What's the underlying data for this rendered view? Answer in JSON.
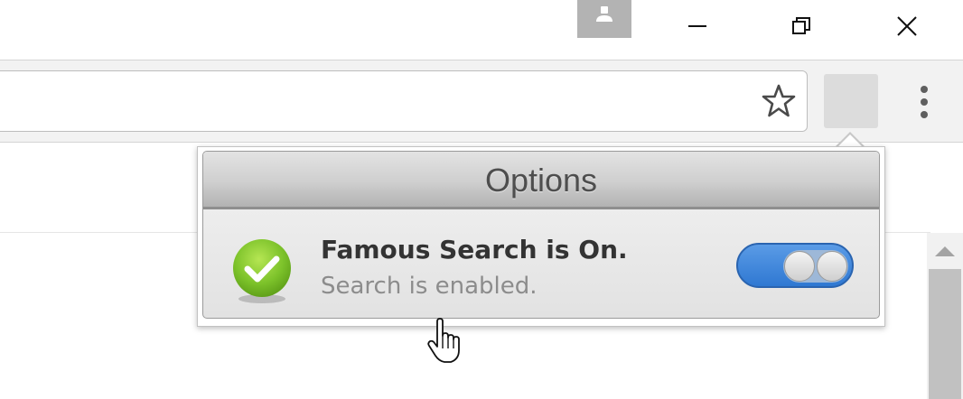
{
  "window": {
    "controls": [
      "minimize-icon",
      "restore-icon",
      "close-icon"
    ],
    "profile_icon": "person-icon"
  },
  "toolbar": {
    "address_value": "",
    "bookmark_icon": "star-icon",
    "extension_icon": "extension-blank-icon",
    "menu_icon": "more-vert-icon"
  },
  "popup": {
    "title": "Options",
    "status_title": "Famous Search is On.",
    "status_subtitle": "Search is enabled.",
    "status_icon": "check-circle-icon",
    "toggle_state": "on",
    "accent_color": "#3b82d8",
    "check_color": "#7cc22a"
  },
  "page": {
    "cursor": "hand-pointer-icon"
  }
}
